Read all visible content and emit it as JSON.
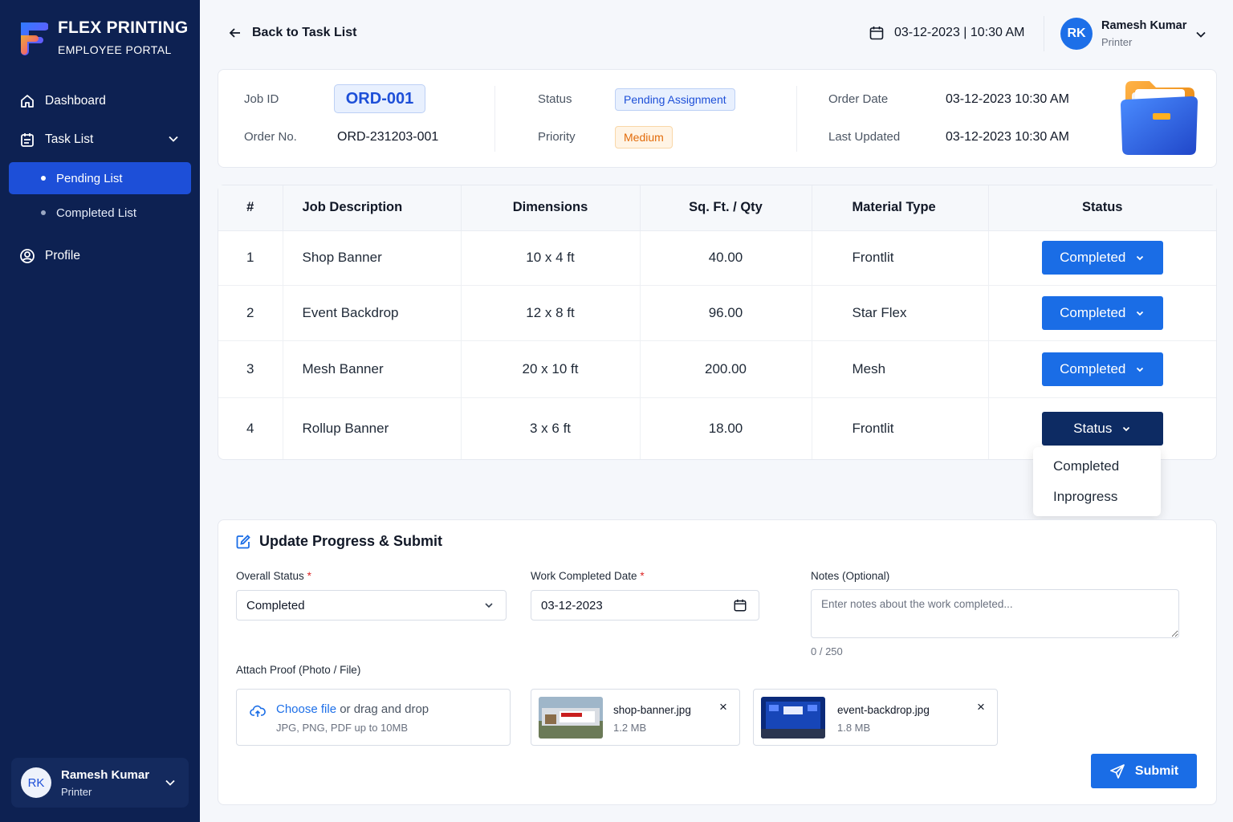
{
  "brand": {
    "title": "FLEX PRINTING",
    "subtitle": "EMPLOYEE PORTAL"
  },
  "nav": {
    "dashboard": "Dashboard",
    "task_list": "Task List",
    "pending_list": "Pending List",
    "completed_list": "Completed List",
    "profile": "Profile"
  },
  "sidebar_user": {
    "initials": "RK",
    "name": "Ramesh Kumar",
    "role": "Printer"
  },
  "header": {
    "back_label": "Back to Task List",
    "datetime": "03-12-2023 | 10:30 AM",
    "user": {
      "initials": "RK",
      "name": "Ramesh Kumar",
      "role": "Printer"
    }
  },
  "job": {
    "job_id_label": "Job ID",
    "job_id": "ORD-001",
    "order_no_label": "Order No.",
    "order_no": "ORD-231203-001",
    "status_label": "Status",
    "status": "Pending Assignment",
    "priority_label": "Priority",
    "priority": "Medium",
    "order_date_label": "Order Date",
    "order_date": "03-12-2023 10:30 AM",
    "last_updated_label": "Last Updated",
    "last_updated": "03-12-2023 10:30 AM"
  },
  "table": {
    "headers": [
      "#",
      "Job Description",
      "Dimensions",
      "Sq. Ft. / Qty",
      "Material Type",
      "Status"
    ],
    "rows": [
      {
        "num": "1",
        "desc": "Shop Banner",
        "dim": "10 x 4 ft",
        "qty": "40.00",
        "material": "Frontlit",
        "status": "Completed"
      },
      {
        "num": "2",
        "desc": "Event Backdrop",
        "dim": "12 x 8 ft",
        "qty": "96.00",
        "material": "Star Flex",
        "status": "Completed"
      },
      {
        "num": "3",
        "desc": "Mesh Banner",
        "dim": "20 x 10 ft",
        "qty": "200.00",
        "material": "Mesh",
        "status": "Completed"
      },
      {
        "num": "4",
        "desc": "Rollup Banner",
        "dim": "3 x 6 ft",
        "qty": "18.00",
        "material": "Frontlit",
        "status": "Status"
      }
    ],
    "dropdown_options": [
      "Completed",
      "Inprogress"
    ]
  },
  "update": {
    "title": "Update Progress & Submit",
    "overall_status_label": "Overall Status",
    "overall_status_value": "Completed",
    "work_date_label": "Work Completed Date",
    "work_date_value": "03-12-2023",
    "required_mark": "*",
    "notes_label": "Notes (Optional)",
    "notes_placeholder": "Enter notes about the work completed...",
    "notes_counter": "0 / 250",
    "attach_label": "Attach Proof (Photo / File)",
    "upload_link": "Choose file",
    "upload_text": " or drag and drop",
    "upload_hint": "JPG, PNG, PDF up to 10MB",
    "files": [
      {
        "name": "shop-banner.jpg",
        "size": "1.2 MB"
      },
      {
        "name": "event-backdrop.jpg",
        "size": "1.8 MB"
      }
    ],
    "remove_symbol": "×",
    "submit_label": "Submit"
  },
  "colors": {
    "sidebar": "#0d2152",
    "primary": "#1a6de6",
    "active_nav": "#1d4fd8",
    "dark_button": "#0d2b63"
  }
}
